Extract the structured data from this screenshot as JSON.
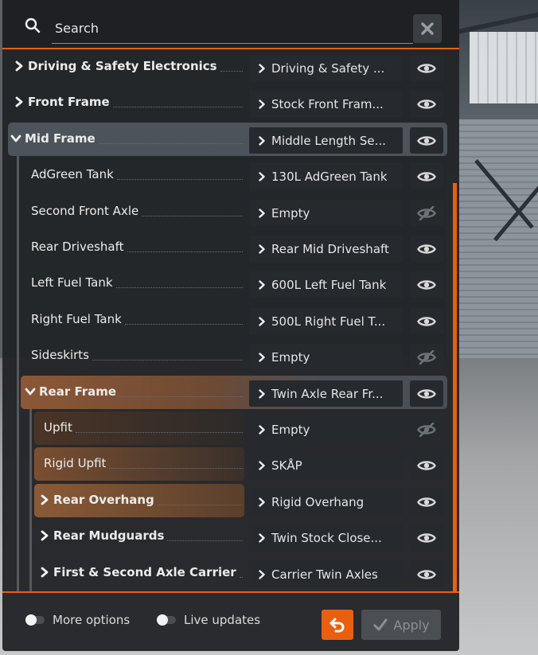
{
  "search": {
    "placeholder": "Search"
  },
  "rows": [
    {
      "label": "Driving & Safety Electronics",
      "value": "Driving & Safety ...",
      "bold": true,
      "expand": "collapsed",
      "visible": true
    },
    {
      "label": "Front Frame",
      "value": "Stock Front Fram...",
      "bold": true,
      "expand": "collapsed",
      "visible": true
    },
    {
      "label": "Mid Frame",
      "value": "Middle Length Se...",
      "bold": true,
      "expand": "expanded",
      "visible": true
    },
    {
      "label": "AdGreen Tank",
      "value": "130L AdGreen Tank",
      "bold": false,
      "visible": true
    },
    {
      "label": "Second Front Axle",
      "value": "Empty",
      "bold": false,
      "visible": false
    },
    {
      "label": "Rear Driveshaft",
      "value": "Rear Mid Driveshaft",
      "bold": false,
      "visible": true
    },
    {
      "label": "Left Fuel Tank",
      "value": "600L Left Fuel Tank",
      "bold": false,
      "visible": true
    },
    {
      "label": "Right Fuel Tank",
      "value": "500L Right Fuel T...",
      "bold": false,
      "visible": true
    },
    {
      "label": "Sideskirts",
      "value": "Empty",
      "bold": false,
      "visible": false
    },
    {
      "label": "Rear Frame",
      "value": "Twin Axle Rear Fr...",
      "bold": true,
      "expand": "expanded",
      "visible": true
    },
    {
      "label": "Upfit",
      "value": "Empty",
      "bold": false,
      "visible": false
    },
    {
      "label": "Rigid Upfit",
      "value": "SKÅP",
      "bold": false,
      "visible": true
    },
    {
      "label": "Rear Overhang",
      "value": "Rigid Overhang",
      "bold": true,
      "expand": "collapsed",
      "visible": true
    },
    {
      "label": "Rear Mudguards",
      "value": "Twin Stock Close...",
      "bold": true,
      "expand": "collapsed",
      "visible": true
    },
    {
      "label": "First & Second Axle Carrier",
      "value": "Carrier Twin Axles",
      "bold": true,
      "expand": "collapsed",
      "visible": true
    }
  ],
  "footer": {
    "more_options": "More options",
    "live_updates": "Live updates",
    "apply": "Apply"
  },
  "colors": {
    "accent": "#e8600f",
    "selected_row": "#4a5058",
    "rear_frame": "#8a5a3a"
  },
  "icons": {
    "search": "search-icon",
    "clear": "close-icon",
    "eye": "eye-icon",
    "eye_off": "eye-off-icon",
    "undo": "undo-icon",
    "apply": "check-icon"
  }
}
